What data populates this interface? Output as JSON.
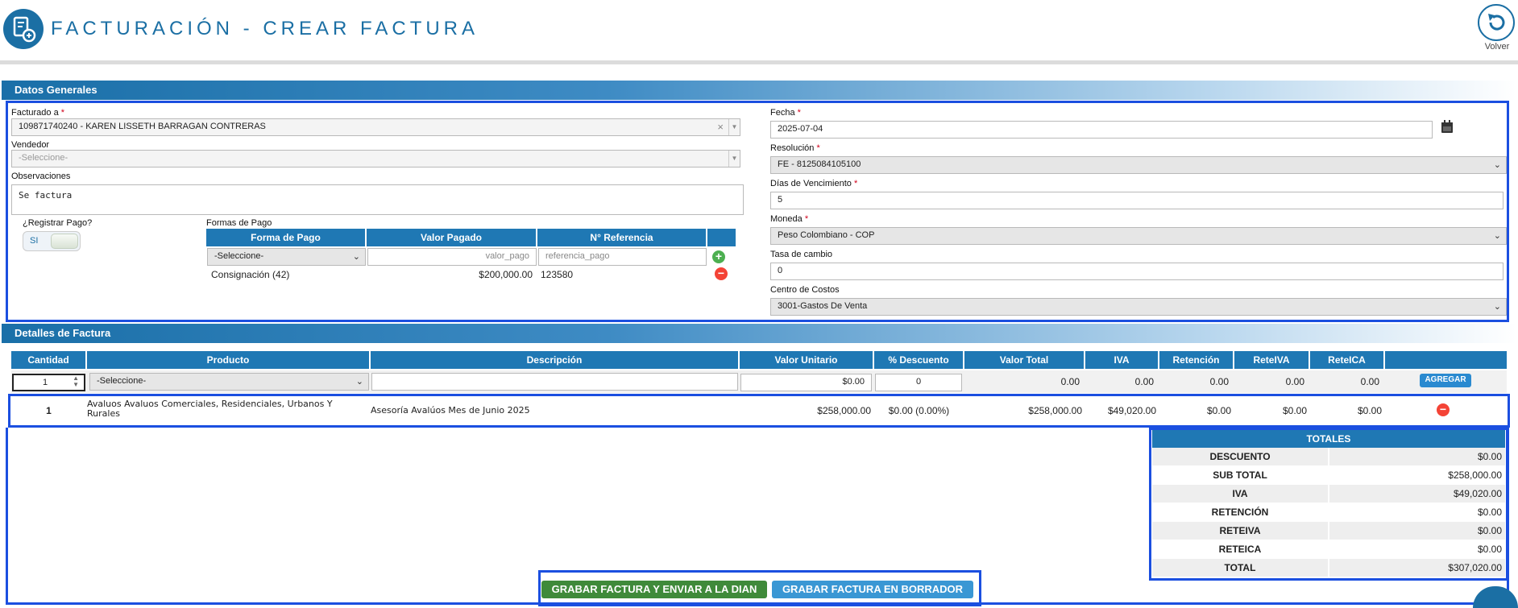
{
  "header": {
    "title": "FACTURACIÓN - CREAR FACTURA",
    "back_label": "Volver"
  },
  "general": {
    "section_title": "Datos Generales",
    "facturado_label": "Facturado a",
    "facturado_value": "109871740240 - KAREN LISSETH BARRAGAN CONTRERAS",
    "vendedor_label": "Vendedor",
    "vendedor_placeholder": "-Seleccione-",
    "observaciones_label": "Observaciones",
    "observaciones_value": "Se factura",
    "registrar_pago_label": "¿Registrar Pago?",
    "registrar_pago_value": "SI",
    "formas_pago_label": "Formas de Pago",
    "fecha_label": "Fecha",
    "fecha_value": "2025-07-04",
    "resolucion_label": "Resolución",
    "resolucion_value": "FE - 8125084105100",
    "dias_label": "Días de Vencimiento",
    "dias_value": "5",
    "moneda_label": "Moneda",
    "moneda_value": "Peso Colombiano - COP",
    "tasa_label": "Tasa de cambio",
    "tasa_value": "0",
    "centro_label": "Centro de Costos",
    "centro_value": "3001-Gastos De Venta",
    "required_mark": "*"
  },
  "payments": {
    "headers": [
      "Forma de Pago",
      "Valor Pagado",
      "N° Referencia"
    ],
    "input_row": {
      "forma_placeholder": "-Seleccione-",
      "valor_placeholder": "valor_pago",
      "ref_placeholder": "referencia_pago"
    },
    "rows": [
      {
        "forma": "Consignación (42)",
        "valor": "$200,000.00",
        "ref": "123580"
      }
    ]
  },
  "details": {
    "section_title": "Detalles de Factura",
    "headers": [
      "Cantidad",
      "Producto",
      "Descripción",
      "Valor Unitario",
      "% Descuento",
      "Valor Total",
      "IVA",
      "Retención",
      "ReteIVA",
      "ReteICA"
    ],
    "input_row": {
      "cantidad": "1",
      "producto_placeholder": "-Seleccione-",
      "valor_unitario": "$0.00",
      "descuento": "0",
      "valor_total": "0.00",
      "iva": "0.00",
      "retencion": "0.00",
      "reteiva": "0.00",
      "reteica": "0.00",
      "add_label": "AGREGAR"
    },
    "rows": [
      {
        "cantidad": "1",
        "producto": "Avaluos Avaluos Comerciales, Residenciales, Urbanos Y Rurales",
        "descripcion": "Asesoría Avalúos Mes de Junio 2025",
        "valor_unitario": "$258,000.00",
        "descuento": "$0.00 (0.00%)",
        "valor_total": "$258,000.00",
        "iva": "$49,020.00",
        "retencion": "$0.00",
        "reteiva": "$0.00",
        "reteica": "$0.00"
      }
    ]
  },
  "totals": {
    "title": "TOTALES",
    "rows": [
      {
        "label": "DESCUENTO",
        "value": "$0.00"
      },
      {
        "label": "SUB TOTAL",
        "value": "$258,000.00"
      },
      {
        "label": "IVA",
        "value": "$49,020.00"
      },
      {
        "label": "RETENCIÓN",
        "value": "$0.00"
      },
      {
        "label": "RETEIVA",
        "value": "$0.00"
      },
      {
        "label": "RETEICA",
        "value": "$0.00"
      },
      {
        "label": "TOTAL",
        "value": "$307,020.00"
      }
    ]
  },
  "actions": {
    "send_dian": "GRABAR FACTURA Y ENVIAR A LA DIAN",
    "draft": "GRABAR FACTURA EN BORRADOR"
  },
  "colors": {
    "primary": "#1b6fa4",
    "table_header": "#1f78b4",
    "highlight_border": "#1b4fe0",
    "send_button": "#3f8a3a",
    "draft_button": "#3a97d4",
    "add_icon": "#4caf50",
    "remove_icon": "#f44336"
  }
}
